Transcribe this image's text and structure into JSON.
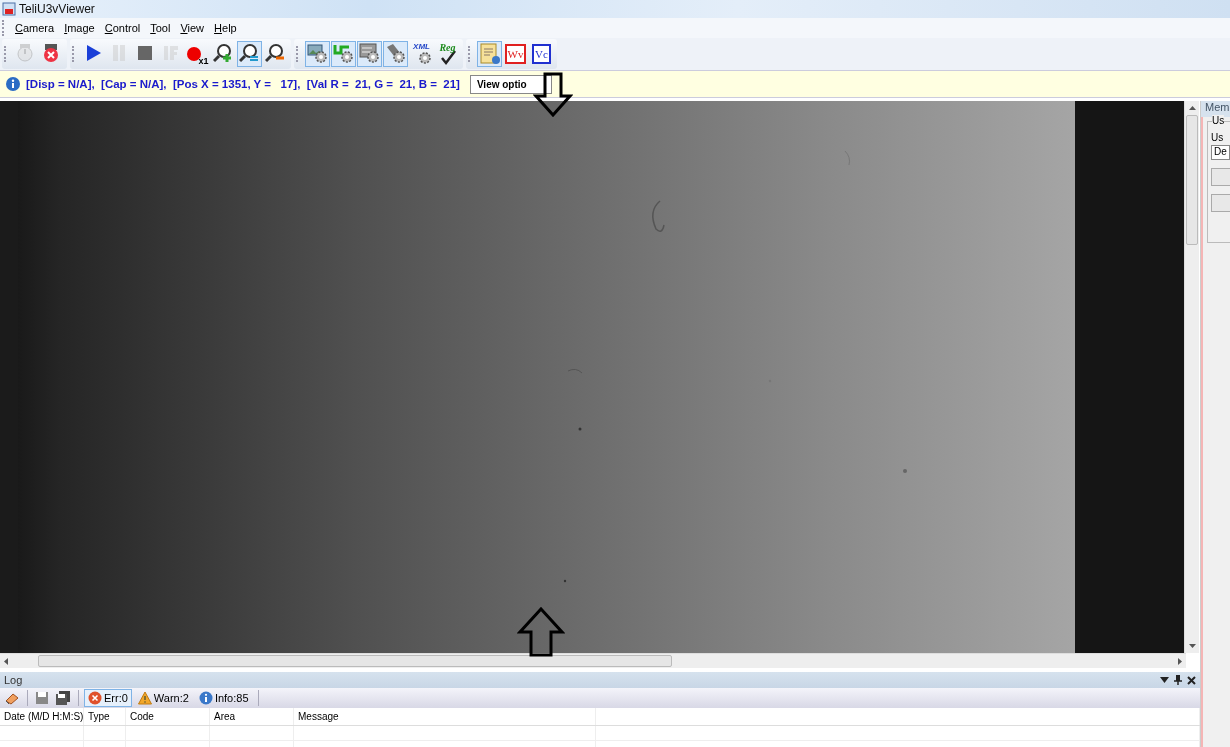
{
  "window": {
    "title": "TeliU3vViewer"
  },
  "menu": [
    {
      "label": "Camera"
    },
    {
      "label": "Image"
    },
    {
      "label": "Control"
    },
    {
      "label": "Tool"
    },
    {
      "label": "View"
    },
    {
      "label": "Help"
    }
  ],
  "toolbar": {
    "groups": [
      {
        "items": [
          {
            "kind": "camera-on",
            "selected": false,
            "disabled": true
          },
          {
            "kind": "camera-off",
            "selected": false,
            "disabled": false
          }
        ]
      },
      {
        "items": [
          {
            "kind": "play",
            "selected": false,
            "disabled": false
          },
          {
            "kind": "pause",
            "selected": false,
            "disabled": true
          },
          {
            "kind": "stop",
            "selected": false,
            "disabled": false
          },
          {
            "kind": "trigger",
            "selected": false,
            "disabled": true
          },
          {
            "kind": "record",
            "text": "x1",
            "selected": false,
            "disabled": false
          },
          {
            "kind": "zoom-in",
            "selected": false,
            "disabled": false
          },
          {
            "kind": "zoom-fit",
            "selected": true,
            "disabled": false
          },
          {
            "kind": "zoom-out",
            "selected": false,
            "disabled": false
          }
        ]
      },
      {
        "items": [
          {
            "kind": "image-gear",
            "selected": true,
            "disabled": false
          },
          {
            "kind": "wave-gear",
            "selected": true,
            "disabled": false
          },
          {
            "kind": "panel-gear",
            "selected": true,
            "disabled": false
          },
          {
            "kind": "tool-gear",
            "selected": true,
            "disabled": false
          },
          {
            "kind": "xml-gear",
            "text": "XML",
            "selected": false,
            "disabled": false
          },
          {
            "kind": "reg-check",
            "text": "Reg",
            "selected": false,
            "disabled": false
          }
        ]
      },
      {
        "items": [
          {
            "kind": "doc-info",
            "selected": true,
            "disabled": false
          },
          {
            "kind": "text-box",
            "text": "Wv",
            "color": "#e02020",
            "selected": false,
            "disabled": false
          },
          {
            "kind": "text-box",
            "text": "Vc",
            "color": "#2030d0",
            "selected": false,
            "disabled": false
          }
        ]
      }
    ]
  },
  "info_bar": {
    "text": "[Disp = N/A],  [Cap = N/A],  [Pos X = 1351, Y =   17],  [Val R =  21, G =  21, B =  21]",
    "button": "View optio"
  },
  "right_panel": {
    "title": "Mem",
    "group_label": "Us",
    "field_label": "Us",
    "field_value": "De"
  },
  "log": {
    "title": "Log",
    "filters": [
      {
        "kind": "error",
        "label": "Err:0",
        "selected": true
      },
      {
        "kind": "warning",
        "label": "Warn:2",
        "selected": false
      },
      {
        "kind": "info",
        "label": "Info:85",
        "selected": false
      }
    ],
    "columns": [
      "Date (M/D H:M:S)",
      "Type",
      "Code",
      "Area",
      "Message"
    ]
  }
}
